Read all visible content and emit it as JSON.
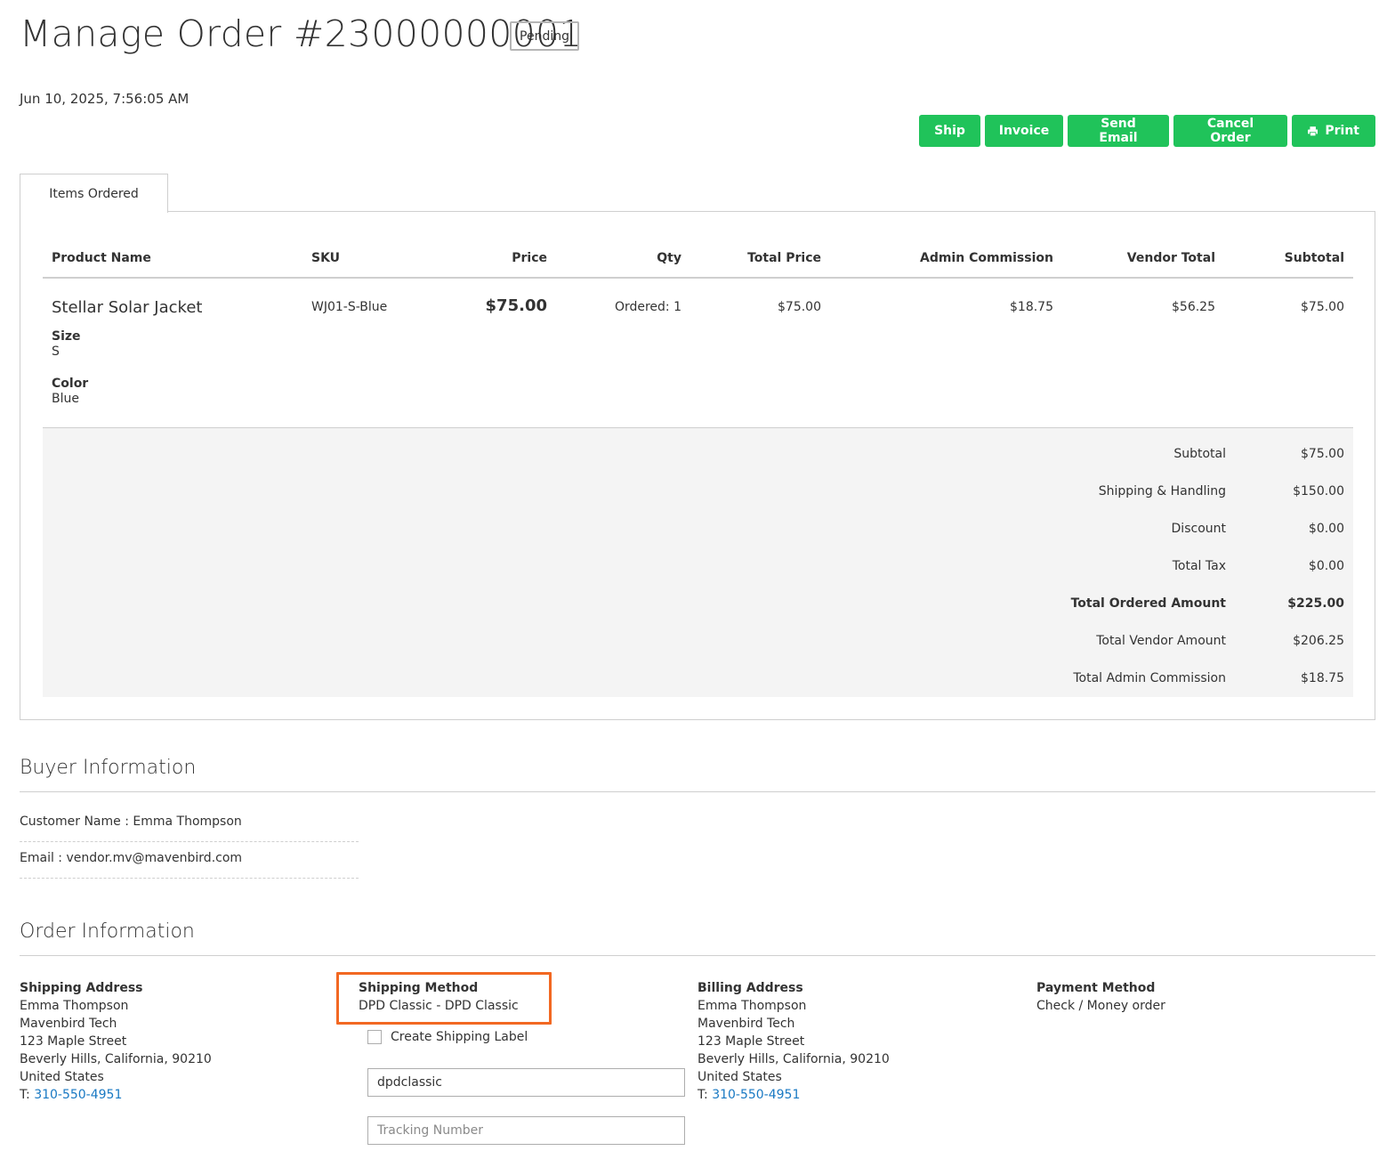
{
  "header": {
    "title": "Manage Order #23000000001",
    "status": "Pending",
    "date": "Jun 10, 2025, 7:56:05 AM"
  },
  "actions": {
    "ship": "Ship",
    "invoice": "Invoice",
    "send_email": "Send Email",
    "cancel_order": "Cancel Order",
    "print": "Print"
  },
  "tab": {
    "label": "Items Ordered"
  },
  "items_table": {
    "columns": [
      "Product Name",
      "SKU",
      "Price",
      "Qty",
      "Total Price",
      "Admin Commission",
      "Vendor Total",
      "Subtotal"
    ],
    "rows": [
      {
        "name": "Stellar Solar Jacket",
        "options": [
          {
            "label": "Size",
            "value": "S"
          },
          {
            "label": "Color",
            "value": "Blue"
          }
        ],
        "sku": "WJ01-S-Blue",
        "price": "$75.00",
        "qty": "Ordered: 1",
        "total_price": "$75.00",
        "admin_commission": "$18.75",
        "vendor_total": "$56.25",
        "subtotal": "$75.00"
      }
    ]
  },
  "totals": [
    {
      "label": "Subtotal",
      "value": "$75.00"
    },
    {
      "label": "Shipping & Handling",
      "value": "$150.00"
    },
    {
      "label": "Discount",
      "value": "$0.00"
    },
    {
      "label": "Total Tax",
      "value": "$0.00"
    },
    {
      "label": "Total Ordered Amount",
      "value": "$225.00"
    },
    {
      "label": "Total Vendor Amount",
      "value": "$206.25"
    },
    {
      "label": "Total Admin Commission",
      "value": "$18.75"
    }
  ],
  "buyer": {
    "title": "Buyer Information",
    "customer_name": "Customer Name : Emma Thompson",
    "email": "Email : vendor.mv@mavenbird.com"
  },
  "order_info": {
    "title": "Order Information",
    "shipping_address": {
      "heading": "Shipping Address",
      "lines": [
        "Emma Thompson",
        "Mavenbird Tech",
        "123 Maple Street",
        "Beverly Hills, California, 90210",
        "United States"
      ],
      "phone_prefix": "T: ",
      "phone": "310-550-4951"
    },
    "shipping_method": {
      "heading": "Shipping Method",
      "value": "DPD Classic - DPD Classic",
      "create_label": "Create Shipping Label",
      "carrier_value": "dpdclassic",
      "tracking_placeholder": "Tracking Number"
    },
    "billing_address": {
      "heading": "Billing Address",
      "lines": [
        "Emma Thompson",
        "Mavenbird Tech",
        "123 Maple Street",
        "Beverly Hills, California, 90210",
        "United States"
      ],
      "phone_prefix": "T: ",
      "phone": "310-550-4951"
    },
    "payment_method": {
      "heading": "Payment Method",
      "value": "Check / Money order"
    }
  },
  "colors": {
    "button_green": "#20c35a",
    "highlight_orange": "#f26822",
    "link_blue": "#1979c3"
  }
}
